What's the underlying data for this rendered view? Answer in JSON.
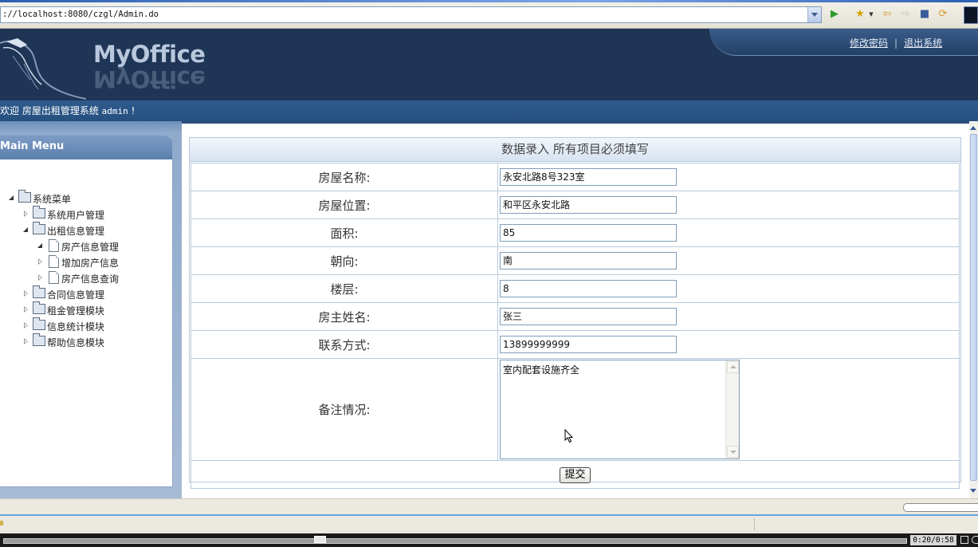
{
  "browser": {
    "url": "://localhost:8080/czgl/Admin.do",
    "icons": [
      "go-icon",
      "favorites-icon",
      "back-icon",
      "forward-icon",
      "stop-icon",
      "refresh-icon"
    ]
  },
  "header": {
    "brand": "MyOffice",
    "links": {
      "change_password": "修改密码",
      "separator": "|",
      "logout": "退出系统"
    }
  },
  "welcome": {
    "prefix": "欢迎 房屋出租管理系统 ",
    "user": "admin",
    "suffix": " !"
  },
  "sidebar": {
    "title": "Main Menu",
    "items": [
      {
        "label": "系统菜单",
        "level": 0,
        "state": "open",
        "icon": "folder-icon"
      },
      {
        "label": "系统用户管理",
        "level": 1,
        "state": "closed",
        "icon": "folder-icon"
      },
      {
        "label": "出租信息管理",
        "level": 1,
        "state": "open",
        "icon": "folder-icon"
      },
      {
        "label": "房产信息管理",
        "level": 2,
        "state": "open",
        "icon": "document-icon"
      },
      {
        "label": "增加房产信息",
        "level": 2,
        "state": "closed",
        "icon": "document-icon"
      },
      {
        "label": "房产信息查询",
        "level": 2,
        "state": "closed",
        "icon": "document-icon"
      },
      {
        "label": "合同信息管理",
        "level": 1,
        "state": "closed",
        "icon": "folder-icon"
      },
      {
        "label": "租金管理模块",
        "level": 1,
        "state": "closed",
        "icon": "folder-icon"
      },
      {
        "label": "信息统计模块",
        "level": 1,
        "state": "closed",
        "icon": "folder-icon"
      },
      {
        "label": "帮助信息模块",
        "level": 1,
        "state": "closed",
        "icon": "folder-icon"
      }
    ]
  },
  "form": {
    "heading": "数据录入 所有项目必须填写",
    "fields": [
      {
        "label": "房屋名称:",
        "value": "永安北路8号323室"
      },
      {
        "label": "房屋位置:",
        "value": "和平区永安北路"
      },
      {
        "label": "面积:",
        "value": "85"
      },
      {
        "label": "朝向:",
        "value": "南"
      },
      {
        "label": "楼层:",
        "value": "8"
      },
      {
        "label": "房主姓名:",
        "value": "张三"
      },
      {
        "label": "联系方式:",
        "value": "13899999999"
      }
    ],
    "remarks": {
      "label": "备注情况:",
      "value": "室内配套设施齐全"
    },
    "submit_label": "提交"
  },
  "player": {
    "time": "0:20/0:58",
    "progress": 0.35
  },
  "colors": {
    "header_bg": "#1f3556",
    "welcome_bg": "#2f5b8c",
    "sidebar_title": "#5b7fae",
    "form_border": "#b9c9dc"
  }
}
